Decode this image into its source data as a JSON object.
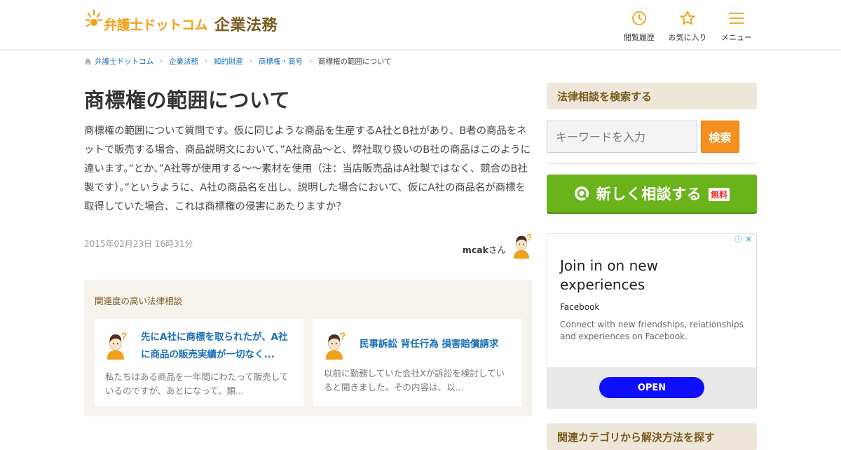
{
  "header": {
    "logo_text": "弁護士ドットコム",
    "logo_sub": "企業法務",
    "nav": [
      {
        "label": "閲覧履歴",
        "icon": "clock-icon"
      },
      {
        "label": "お気に入り",
        "icon": "star-icon"
      },
      {
        "label": "メニュー",
        "icon": "hamburger-menu-icon"
      }
    ],
    "accent_color": "#f0a01a"
  },
  "breadcrumb": [
    "弁護士ドットコム",
    "企業法務",
    "知的財産",
    "商標権・商号",
    "商標権の範囲について"
  ],
  "article": {
    "title": "商標権の範囲について",
    "body": "商標権の範囲について質問です。仮に同じような商品を生産するA社とB社があり、B者の商品をネットで販売する場合、商品説明文において、”A社商品～と、弊社取り扱いのB社の商品はこのように違います。”とか、”A社等が使用する～～素材を使用（注：当店販売品はA社製ではなく、競合のB社製です）。”というように、A社の商品名を出し、説明した場合において、仮にA社の商品名が商標を取得していた場合、これは商標権の侵害にあたりますか？",
    "date": "2015年02月23日 16時31分",
    "author": "mcak",
    "author_suffix": "さん"
  },
  "related": {
    "heading": "関連度の高い法律相談",
    "items": [
      {
        "title": "先にA社に商標を取られたが、A社に商品の販売実績が一切なく...",
        "desc": "私たちはある商品を一年間にわたって販売しているのですが、あとになって、類..."
      },
      {
        "title": "民事訴訟 背任行為 損害賠償請求",
        "desc": "以前に勤務していた会社Xが訴訟を検討していると聞きました。その内容は、以..."
      }
    ]
  },
  "sidebar": {
    "search_heading": "法律相談を検索する",
    "search_placeholder": "キーワードを入力",
    "search_button": "検索",
    "consult_button": "新しく相談する",
    "consult_badge": "無料",
    "category_heading": "関連カテゴリから解決方法を探す",
    "consult_color": "#6bb31b",
    "search_color": "#f5901e"
  },
  "ad": {
    "title": "Join in on new experiences",
    "brand": "Facebook",
    "description": "Connect with new friendships, relationships and experiences on Facebook.",
    "button": "OPEN"
  }
}
